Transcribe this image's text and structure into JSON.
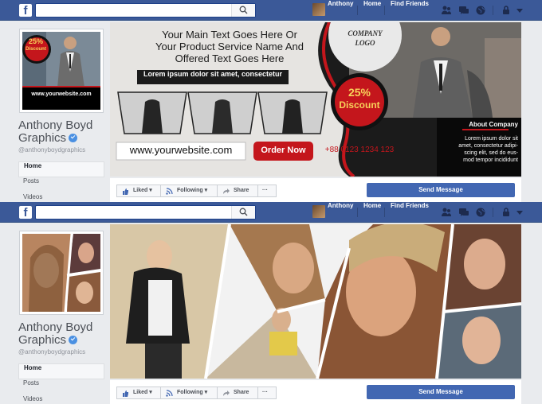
{
  "topbar": {
    "logo": "f",
    "search_placeholder": "",
    "user_name": "Anthony",
    "home": "Home",
    "find_friends": "Find Friends"
  },
  "profile": {
    "name_line1": "Anthony Boyd",
    "name_line2": "Graphics",
    "handle": "@anthonyboydgraphics"
  },
  "sidebar": {
    "items": [
      {
        "label": "Home"
      },
      {
        "label": "Posts"
      },
      {
        "label": "Videos"
      }
    ]
  },
  "actions": {
    "liked": "Liked",
    "following": "Following",
    "share": "Share",
    "more": "···",
    "send_message": "Send Message"
  },
  "cover1": {
    "headline_line1": "Your Main Text Goes Here Or",
    "headline_line2": "Your Product Service Name And",
    "headline_line3": "Offered Text Goes Here",
    "sub_banner": "Lorem ipsum dolor sit amet, consectetur",
    "website": "www.yourwebsite.com",
    "order_now": "Order Now",
    "phone": "+88 0123 1234 123",
    "logo_line1": "COMPANY",
    "logo_line2": "LOGO",
    "discount_pct": "25%",
    "discount_label": "Discount",
    "about_title": "About Company",
    "about_line1": "Lorem ipsum dolor sit",
    "about_line2": "amet, consectetur adipi-",
    "about_line3": "scing elit, sed do eus-",
    "about_line4": "mod tempor incididunt"
  },
  "profile_pic1": {
    "discount_pct": "25%",
    "discount_label": "Discount",
    "website": "www.yourwebsite.com"
  },
  "colors": {
    "facebook_blue": "#3b5998",
    "button_blue": "#4267b2",
    "accent_red": "#c4161c",
    "background": "#e9ebee"
  },
  "icons": [
    "facebook-logo-icon",
    "search-icon",
    "friends-icon",
    "messages-icon",
    "globe-icon",
    "lock-icon",
    "caret-down-icon",
    "thumbs-up-icon",
    "rss-icon",
    "share-arrow-icon"
  ]
}
